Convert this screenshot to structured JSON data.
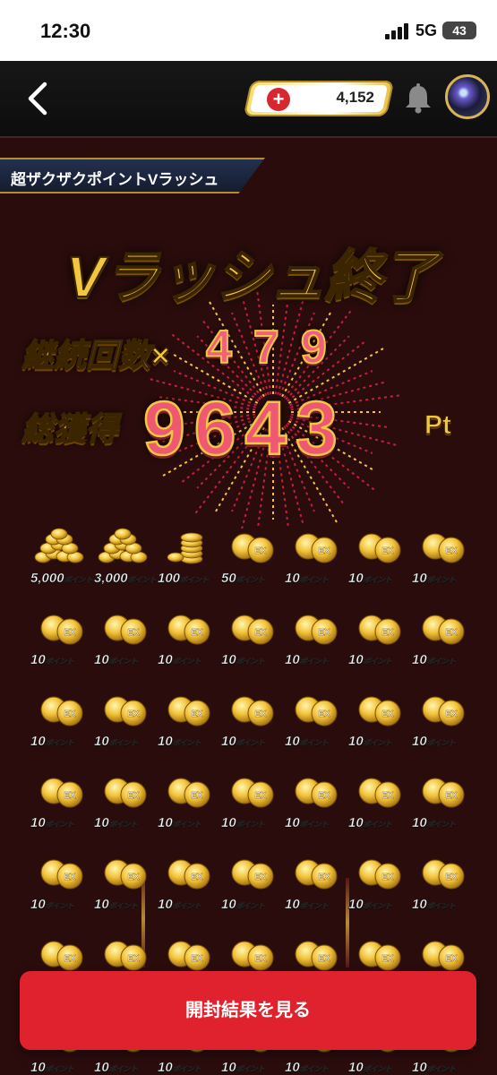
{
  "status": {
    "time": "12:30",
    "network": "5G",
    "battery": "43"
  },
  "header": {
    "points": "4,152",
    "plus": "+"
  },
  "campaign": {
    "title": "超ザクザクポイントVラッシュ"
  },
  "result": {
    "title": "Vラッシュ終了",
    "streak_label": "継続回数×",
    "streak_value": "479",
    "total_label": "総獲得",
    "total_value": "9643",
    "total_unit": "Pt"
  },
  "prizes": [
    {
      "value": "5,000",
      "unit": "ポイント",
      "kind": "coin-pile-large"
    },
    {
      "value": "3,000",
      "unit": "ポイント",
      "kind": "coin-pile-large"
    },
    {
      "value": "100",
      "unit": "ポイント",
      "kind": "coin-stack"
    },
    {
      "value": "50",
      "unit": "ポイント",
      "kind": "ex-coin"
    },
    {
      "value": "10",
      "unit": "ポイント",
      "kind": "ex-coin"
    },
    {
      "value": "10",
      "unit": "ポイント",
      "kind": "ex-coin"
    },
    {
      "value": "10",
      "unit": "ポイント",
      "kind": "ex-coin"
    }
  ],
  "repeated_prize": {
    "value": "10",
    "unit": "ポイント",
    "kind": "ex-coin"
  },
  "cta": {
    "label": "開封結果を見る"
  },
  "colors": {
    "accent": "#e0222e",
    "gold": "#f3c640",
    "background": "#2a0c0c"
  }
}
